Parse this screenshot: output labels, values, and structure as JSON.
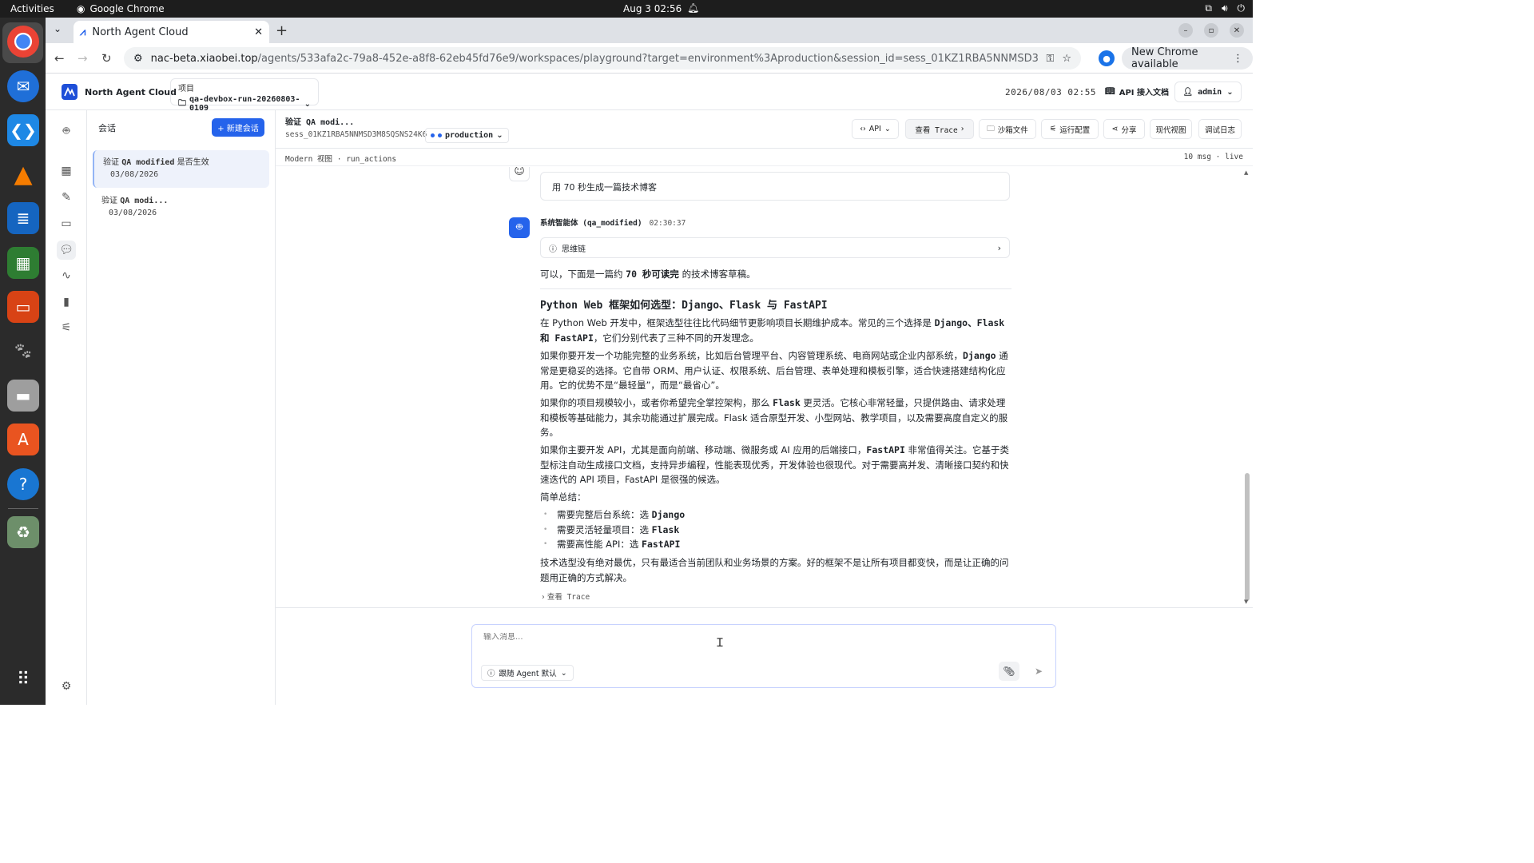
{
  "topbar": {
    "activities": "Activities",
    "app_name": "Google Chrome",
    "clock": "Aug 3  02:56"
  },
  "browser": {
    "tab_title": "North Agent Cloud",
    "url_host": "nac-beta.xiaobei.top",
    "url_path": "/agents/533afa2c-79a8-452e-a8f8-62eb45fd76e9/workspaces/playground?target=environment%3Aproduction&session_id=sess_01KZ1RBA5NNMSD3M8SQSNS24K6",
    "update_label": "New Chrome available"
  },
  "header": {
    "brand": "North Agent Cloud",
    "project_label": "项目",
    "project_value": "qa-devbox-run-20260803-0109",
    "datetime": "2026/08/03 02:55",
    "api_docs": "API 接入文档",
    "user": "admin"
  },
  "sessions": {
    "title": "会话",
    "new_button": "+ 新建会话",
    "items": [
      {
        "name_prefix": "验证 ",
        "name_mono": "QA modified",
        "name_suffix": " 是否生效",
        "date": "03/08/2026"
      },
      {
        "name_prefix": "验证 ",
        "name_mono": "QA modi...",
        "name_suffix": "",
        "date": "03/08/2026"
      }
    ]
  },
  "main": {
    "session_name": "验证 QA modi...",
    "session_id": "sess_01KZ1RBA5NNMSD3M8SQSNS24K6",
    "environment": "production",
    "buttons": {
      "api": "API",
      "trace": "查看 Trace",
      "sandbox": "沙箱文件",
      "run_config": "运行配置",
      "share": "分享",
      "modern_view": "现代视图",
      "debug_log": "调试日志"
    },
    "subbar_left": "Modern 视图 · run_actions",
    "subbar_right": "10 msg · live"
  },
  "chat": {
    "user_message": "用 70 秒生成一篇技术博客",
    "bot_name": "系统智能体 (qa_modified)",
    "bot_time": "02:30:37",
    "thinking_label": "思维链",
    "intro_a": "可以，下面是一篇约 ",
    "intro_b": "70 秒可读完",
    "intro_c": " 的技术博客草稿。",
    "heading": "Python Web 框架如何选型：Django、Flask 与 FastAPI",
    "p1_a": "在 Python Web 开发中，框架选型往往比代码细节更影响项目长期维护成本。常见的三个选择是 ",
    "p1_b": "Django、Flask 和 FastAPI",
    "p1_c": "，它们分别代表了三种不同的开发理念。",
    "p2_a": "如果你要开发一个功能完整的业务系统，比如后台管理平台、内容管理系统、电商网站或企业内部系统，",
    "p2_b": "Django",
    "p2_c": " 通常是更稳妥的选择。它自带 ORM、用户认证、权限系统、后台管理、表单处理和模板引擎，适合快速搭建结构化应用。它的优势不是“最轻量”，而是“最省心”。",
    "p3_a": "如果你的项目规模较小，或者你希望完全掌控架构，那么 ",
    "p3_b": "Flask",
    "p3_c": " 更灵活。它核心非常轻量，只提供路由、请求处理和模板等基础能力，其余功能通过扩展完成。Flask 适合原型开发、小型网站、教学项目，以及需要高度自定义的服务。",
    "p4_a": "如果你主要开发 API，尤其是面向前端、移动端、微服务或 AI 应用的后端接口，",
    "p4_b": "FastAPI",
    "p4_c": " 非常值得关注。它基于类型标注自动生成接口文档，支持异步编程，性能表现优秀，开发体验也很现代。对于需要高并发、清晰接口契约和快速迭代的 API 项目，FastAPI 是很强的候选。",
    "summary_label": "简单总结：",
    "summary_items": [
      {
        "text": "需要完整后台系统：选 ",
        "bold": "Django"
      },
      {
        "text": "需要灵活轻量项目：选 ",
        "bold": "Flask"
      },
      {
        "text": "需要高性能 API：选 ",
        "bold": "FastAPI"
      }
    ],
    "closing": "技术选型没有绝对最优，只有最适合当前团队和业务场景的方案。好的框架不是让所有项目都变快，而是让正确的问题用正确的方式解决。",
    "trace_link": "查看 Trace"
  },
  "composer": {
    "placeholder": "输入消息...",
    "agent_mode": "跟随 Agent 默认"
  }
}
